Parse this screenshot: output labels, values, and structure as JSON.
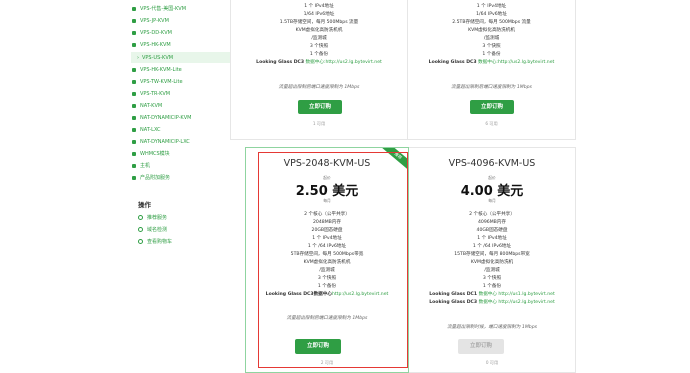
{
  "sidebar": {
    "items": [
      {
        "label": "VPS-代售-美国-KVM",
        "active": false
      },
      {
        "label": "VPS-JP-KVM",
        "active": false
      },
      {
        "label": "VPS-DD-KVM",
        "active": false
      },
      {
        "label": "VPS-HK-KVM",
        "active": false
      },
      {
        "label": "VPS-US-KVM",
        "active": true
      },
      {
        "label": "VPS-HK-KVM-Lite",
        "active": false
      },
      {
        "label": "VPS-TW-KVM-Lite",
        "active": false
      },
      {
        "label": "VPS-TR-KVM",
        "active": false
      },
      {
        "label": "NAT-KVM",
        "active": false
      },
      {
        "label": "NAT-DYNAMICIP-KVM",
        "active": false
      },
      {
        "label": "NAT-LXC",
        "active": false
      },
      {
        "label": "NAT-DYNAMICIP-LXC",
        "active": false
      },
      {
        "label": "WHMCS模块",
        "active": false
      },
      {
        "label": "主机",
        "active": false
      },
      {
        "label": "产品附加服务",
        "active": false
      }
    ],
    "actions_title": "操作",
    "actions": [
      {
        "label": "推荐服务"
      },
      {
        "label": "域名检测"
      },
      {
        "label": "查看购物车"
      }
    ]
  },
  "top_left_card": {
    "lines": [
      "1 个 IPv4地址",
      "1/64 IPv6地址",
      "1.5TB存储空间，每月 500Mbps 流量",
      "KVM虚拟化高防洗机机",
      "/监测城",
      "3 个快照",
      "1 个备份"
    ],
    "looking_glass_label": "Looking Glass DC3",
    "looking_glass_link": "数据中心:http://us2.lg.bytevirt.net",
    "note": "流量超出限制后端口速度限制为 1Mbps",
    "buy_label": "立即订购",
    "stock": "1 可用"
  },
  "top_right_card": {
    "lines": [
      "1 个 IPv4地址",
      "1/64 IPv6地址",
      "2.5TB存储空间，每月 500Mbps 流量",
      "KVM虚拟化高防洗机机",
      "/监测城",
      "3 个快照",
      "1 个备份"
    ],
    "looking_glass_label": "Looking Glass DC3",
    "looking_glass_link": "数据中心:http://us2.lg.bytevirt.net",
    "note": "流量超出限制后端口速度限制为 1Mbps",
    "buy_label": "立即订购",
    "stock": "6 可用"
  },
  "plan_2048": {
    "ribbon": "推荐",
    "title": "VPS-2048-KVM-US",
    "price_caption": "起价",
    "price": "2.50 美元",
    "period": "每月",
    "lines": [
      "2 个核心（公平共享）",
      "2048MB内存",
      "20GB固态硬盘",
      "1 个 IPv4地址",
      "1 个 /64 IPv6地址",
      "5TB存储空间，每月 500Mbps带宽",
      "KVM虚拟化高防洗机机",
      "/监测城",
      "3 个快照",
      "1 个备份"
    ],
    "looking_glass_label": "Looking Glass DC3数据中心",
    "looking_glass_link": "http://us2.lg.bytevirt.net",
    "note": "流量超出限制后端口速度限制为 1Mbps",
    "buy_label": "立即订购",
    "stock": "2 可用"
  },
  "plan_4096": {
    "title": "VPS-4096-KVM-US",
    "price_caption": "起价",
    "price": "4.00 美元",
    "period": "每月",
    "lines": [
      "2 个核心（公平共享）",
      "4096MB内存",
      "40GB固态硬盘",
      "1 个 IPv4地址",
      "1 个 /64 IPv6地址",
      "15TB存储空间，每月 800Mbps带宽",
      "KVM虚拟化高防洗机",
      "/监测城",
      "3 个快照",
      "1 个备份"
    ],
    "looking_glass_1_label": "Looking Glass DC1",
    "looking_glass_1_link": "数据中心 http://us1.lg.bytevirt.net",
    "looking_glass_2_label": "Looking Glass DC3",
    "looking_glass_2_link": "数据中心 http://us2.lg.bytevirt.net",
    "note": "流量超出限制时候，端口速度限制为 1Mbps",
    "buy_label": "立即订购",
    "stock": "0 可用"
  },
  "colors": {
    "accent": "#2f9e44",
    "highlight": "#e53935"
  }
}
